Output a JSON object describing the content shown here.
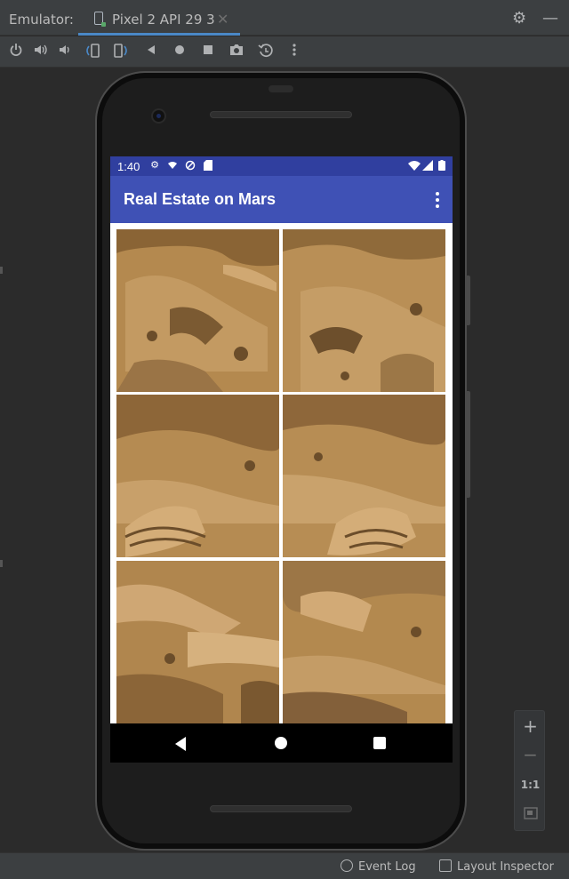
{
  "window": {
    "title": "Emulator:",
    "tab_label": "Pixel 2 API 29 3",
    "tab_close": "✕",
    "settings_icon": "gear-icon",
    "minimize_icon": "minimize-icon"
  },
  "toolbar": {
    "items": [
      "power-icon",
      "volume-up-icon",
      "volume-down-icon",
      "rotate-left-icon",
      "rotate-right-icon",
      "back-icon",
      "home-icon",
      "overview-icon",
      "screenshot-icon",
      "snapshot-icon",
      "more-icon"
    ]
  },
  "device": {
    "status_time": "1:40",
    "app_title": "Real Estate on Mars",
    "accent": "#3f51b5",
    "status_color": "#303f9f"
  },
  "zoom": {
    "plus": "+",
    "minus": "−",
    "one_to_one": "1:1"
  },
  "footer": {
    "event_log": "Event Log",
    "layout_inspector": "Layout Inspector"
  }
}
